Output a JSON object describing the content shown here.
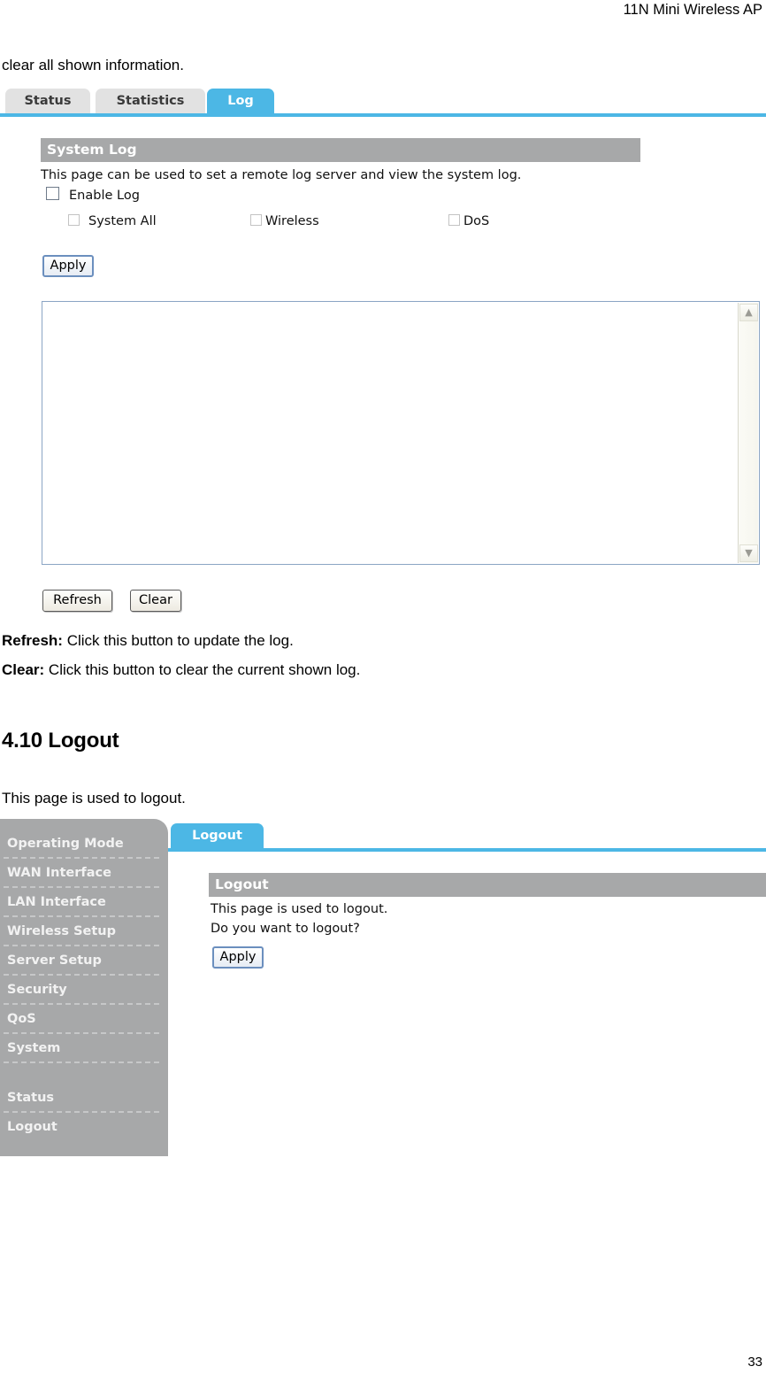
{
  "document": {
    "running_header": "11N Mini Wireless AP",
    "page_number": "33",
    "lead_text": "clear all shown information.",
    "refresh_desc_label": "Refresh:",
    "refresh_desc_text": " Click this button to update the log.",
    "clear_desc_label": "Clear:",
    "clear_desc_text": " Click this button to clear the current shown log.",
    "section_heading": "4.10 Logout",
    "logout_intro": "This page is used to logout."
  },
  "log_screen": {
    "tabs": [
      {
        "label": "Status",
        "active": false
      },
      {
        "label": "Statistics",
        "active": false
      },
      {
        "label": "Log",
        "active": true
      }
    ],
    "panel_title": "System Log",
    "description": "This page can be used to set a remote log server and view the system log.",
    "enable_log_label": "Enable Log",
    "enable_log_checked": false,
    "sub_options": [
      {
        "label": "System All",
        "checked": false
      },
      {
        "label": "Wireless",
        "checked": false
      },
      {
        "label": "DoS",
        "checked": false
      }
    ],
    "apply_label": "Apply",
    "log_text": "",
    "refresh_label": "Refresh",
    "clear_label": "Clear",
    "scroll_up_glyph": "▲",
    "scroll_down_glyph": "▼"
  },
  "logout_screen": {
    "sidebar_items": [
      "Operating Mode",
      "WAN Interface",
      "LAN Interface",
      "Wireless Setup",
      "Server Setup",
      "Security",
      "QoS",
      "System"
    ],
    "sidebar_items_bottom": [
      "Status",
      "Logout"
    ],
    "tabs": [
      {
        "label": "Logout",
        "active": true
      }
    ],
    "panel_title": "Logout",
    "line1": "This page is used to logout.",
    "line2": "Do you want to logout?",
    "apply_label": "Apply"
  },
  "colors": {
    "accent_blue": "#4cb7e5",
    "band_gray": "#a7a8a9",
    "tab_inactive": "#e2e2e2"
  }
}
